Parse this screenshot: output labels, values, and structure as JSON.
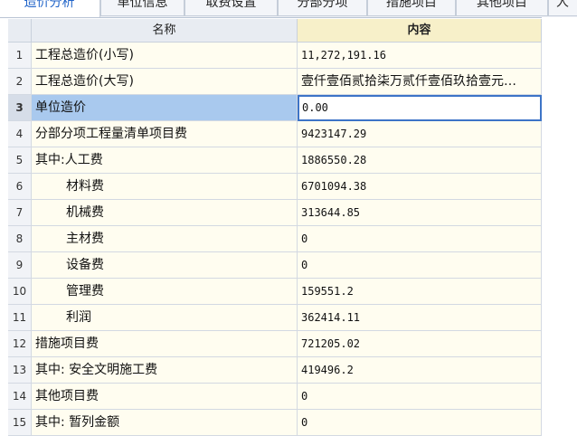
{
  "tabs": [
    {
      "label": "造价分析",
      "active": true
    },
    {
      "label": "单位信息",
      "active": false
    },
    {
      "label": "取费设置",
      "active": false
    },
    {
      "label": "分部分项",
      "active": false
    },
    {
      "label": "措施项目",
      "active": false
    },
    {
      "label": "其他项目",
      "active": false
    },
    {
      "label": "人",
      "active": false
    }
  ],
  "table": {
    "header_name": "名称",
    "header_value": "内容",
    "rows": [
      {
        "num": "1",
        "name": "工程总造价(小写)",
        "value": "11,272,191.16"
      },
      {
        "num": "2",
        "name": "工程总造价(大写)",
        "value": "壹仟壹佰贰拾柒万贰仟壹佰玖拾壹元…"
      },
      {
        "num": "3",
        "name": "单位造价",
        "value": "0.00"
      },
      {
        "num": "4",
        "name": "分部分项工程量清单项目费",
        "value": "9423147.29"
      },
      {
        "num": "5",
        "name": "其中:人工费",
        "value": "1886550.28"
      },
      {
        "num": "6",
        "name": "材料费",
        "value": "6701094.38"
      },
      {
        "num": "7",
        "name": "机械费",
        "value": "313644.85"
      },
      {
        "num": "8",
        "name": "主材费",
        "value": "0"
      },
      {
        "num": "9",
        "name": "设备费",
        "value": "0"
      },
      {
        "num": "10",
        "name": "管理费",
        "value": "159551.2"
      },
      {
        "num": "11",
        "name": "利润",
        "value": "362414.11"
      },
      {
        "num": "12",
        "name": "措施项目费",
        "value": "721205.02"
      },
      {
        "num": "13",
        "name": "其中: 安全文明施工费",
        "value": "419496.2"
      },
      {
        "num": "14",
        "name": "其他项目费",
        "value": "0"
      },
      {
        "num": "15",
        "name": "其中: 暂列金额",
        "value": "0"
      }
    ]
  },
  "colors": {
    "tab_active_text": "#1f63c8",
    "selection_fill": "#a9c9ee",
    "selection_border": "#3d74c7",
    "value_header_fill": "#f7f0c9"
  }
}
